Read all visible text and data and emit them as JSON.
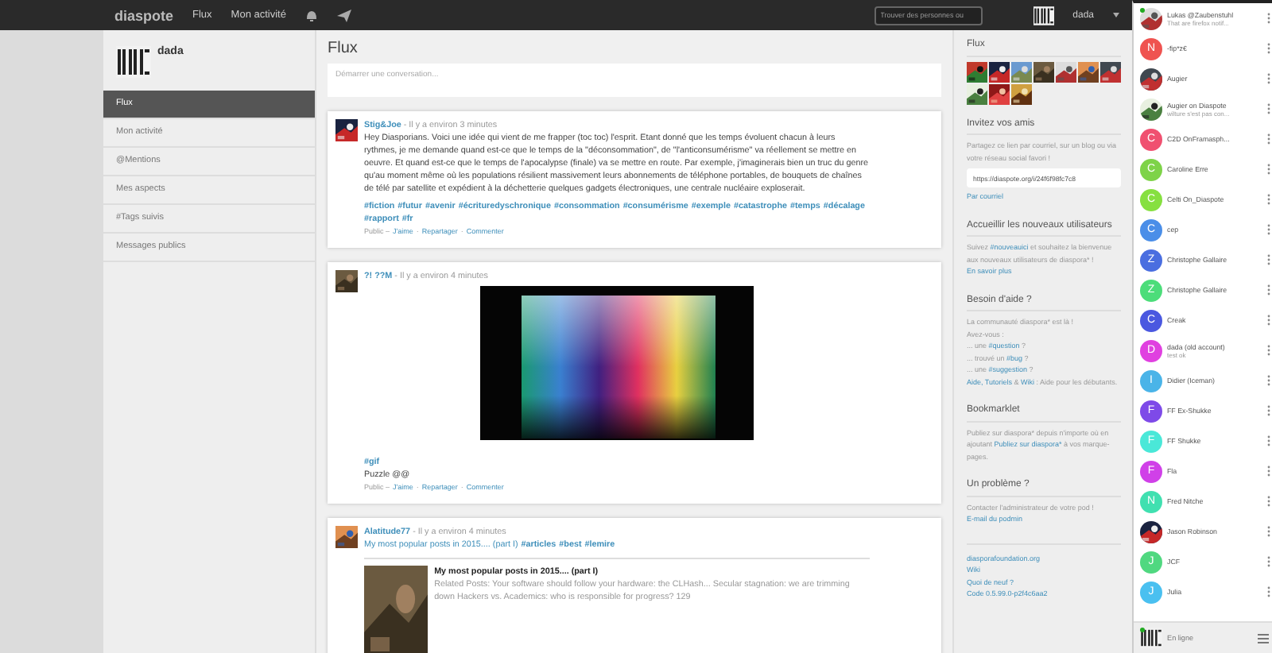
{
  "topbar": {
    "brand": "diaspote",
    "nav": [
      {
        "label": "Flux"
      },
      {
        "label": "Mon activité"
      }
    ],
    "search": {
      "placeholder": "Trouver des personnes ou"
    },
    "user": "dada"
  },
  "sidebar": {
    "user": "dada",
    "items": [
      {
        "label": "Flux",
        "selected": true
      },
      {
        "label": "Mon activité",
        "selected": false
      },
      {
        "label": "@Mentions",
        "selected": false
      },
      {
        "label": "Mes aspects",
        "selected": false
      },
      {
        "label": "#Tags suivis",
        "selected": false
      },
      {
        "label": "Messages publics",
        "selected": false
      }
    ]
  },
  "main": {
    "title": "Flux",
    "composer": {
      "placeholder": "Démarrer une conversation..."
    },
    "posts": [
      {
        "kind": "text",
        "author": "Stig&Joe",
        "time": "- Il y a environ 3 minutes",
        "body": "Hey Diasporians. Voici une idée qui vient de me frapper (toc toc) l'esprit. Etant donné que les temps évoluent chacun à leurs rythmes, je me demande quand est-ce que le temps de la \"déconsommation\", de \"l'anticonsumérisme\" va réellement se mettre en oeuvre. Et quand est-ce que le temps de l'apocalypse (finale) va se mettre en route. Par exemple, j'imaginerais bien un truc du genre qu'au moment même où les populations résilient massivement leurs abonnements de téléphone portables, de bouquets de chaînes de télé par satellite et expédient à la déchetterie quelques gadgets électroniques, une centrale nucléaire exploserait.",
        "tags": [
          "#fiction",
          "#futur",
          "#avenir",
          "#écrituredyschronique",
          "#consommation",
          "#consumérisme",
          "#exemple",
          "#catastrophe",
          "#temps",
          "#décalage",
          "#rapport",
          "#fr"
        ],
        "meta": [
          {
            "kind": "text",
            "text": "Public –"
          },
          {
            "kind": "link",
            "text": "J'aime"
          },
          {
            "kind": "text",
            "text": "·"
          },
          {
            "kind": "link",
            "text": "Repartager"
          },
          {
            "kind": "text",
            "text": "·"
          },
          {
            "kind": "link",
            "text": "Commenter"
          }
        ]
      },
      {
        "author": "?! ??M",
        "time": "- Il y a environ 4 minutes",
        "tags": [
          "#gif"
        ],
        "body": "Puzzle @@",
        "meta": [
          {
            "kind": "text",
            "text": "Public –"
          },
          {
            "kind": "link",
            "text": "J'aime"
          },
          {
            "kind": "text",
            "text": "·"
          },
          {
            "kind": "link",
            "text": "Repartager"
          },
          {
            "kind": "text",
            "text": "·"
          },
          {
            "kind": "link",
            "text": "Commenter"
          }
        ]
      },
      {
        "kind": "link",
        "author": "Alatitude77",
        "time": "- Il y a environ 4 minutes",
        "title": "My most popular posts in 2015.... (part I)",
        "tags": [
          "#articles",
          "#best",
          "#lemire"
        ],
        "embed": {
          "title": "My most popular posts in 2015.... (part I)",
          "description": "Related Posts: Your software should follow your hardware: the CLHash... Secular stagnation: we are trimming down Hackers vs. Academics: who is responsible for progress? 129"
        }
      }
    ]
  },
  "aside": {
    "flux": {
      "title": "Flux"
    },
    "sections": [
      {
        "title": "Invitez vos amis",
        "paragraphs": [
          [
            {
              "kind": "text",
              "text": "Partagez ce lien par courriel, sur un blog ou via votre réseau social favori !"
            }
          ]
        ],
        "field": "https://diaspote.org/i/24f6f98fc7c8",
        "links": [
          "Par courriel"
        ]
      },
      {
        "title": "Accueillir les nouveaux utilisateurs",
        "paragraphs": [
          [
            {
              "kind": "text",
              "text": "Suivez "
            },
            {
              "kind": "link",
              "text": "#nouveauici"
            },
            {
              "kind": "text",
              "text": " et souhaitez la bienvenue aux nouveaux utilisateurs de diaspora* !"
            }
          ]
        ],
        "links": [
          "En savoir plus"
        ]
      },
      {
        "title": "Besoin d'aide ?",
        "paragraphs": [
          [
            {
              "kind": "text",
              "text": "La communauté diaspora* est là !"
            }
          ],
          [
            {
              "kind": "text",
              "text": "Avez-vous :"
            }
          ],
          [
            {
              "kind": "text",
              "text": "... une "
            },
            {
              "kind": "link",
              "text": "#question"
            },
            {
              "kind": "text",
              "text": " ?"
            }
          ],
          [
            {
              "kind": "text",
              "text": "... trouvé un "
            },
            {
              "kind": "link",
              "text": "#bug"
            },
            {
              "kind": "text",
              "text": " ?"
            }
          ],
          [
            {
              "kind": "text",
              "text": "... une "
            },
            {
              "kind": "link",
              "text": "#suggestion"
            },
            {
              "kind": "text",
              "text": " ?"
            }
          ],
          [
            {
              "kind": "link",
              "text": "Aide, Tutoriels"
            },
            {
              "kind": "text",
              "text": " & "
            },
            {
              "kind": "link",
              "text": "Wiki"
            },
            {
              "kind": "text",
              "text": " : Aide pour les débutants."
            }
          ]
        ]
      },
      {
        "title": "Bookmarklet",
        "paragraphs": [
          [
            {
              "kind": "text",
              "text": "Publiez sur diaspora* depuis n'importe où en ajoutant "
            },
            {
              "kind": "link",
              "text": "Publiez sur diaspora*"
            },
            {
              "kind": "text",
              "text": " à vos marque-pages."
            }
          ]
        ]
      },
      {
        "title": "Un problème ?",
        "paragraphs": [
          [
            {
              "kind": "text",
              "text": "Contacter l'administrateur de votre pod !"
            }
          ]
        ],
        "links": [
          "E-mail du podmin"
        ]
      }
    ],
    "footer_links": [
      "diasporafoundation.org",
      "Wiki",
      "Quoi de neuf ?",
      "Code 0.5.99.0-p2f4c6aa2"
    ]
  },
  "chat": {
    "contacts": [
      {
        "name": "Lukas @Zaubenstuhl",
        "status": "That are firefox notif...",
        "online": true
      },
      {
        "name": "-fip*z€",
        "avatar": {
          "kind": "letter",
          "letter": "N",
          "color": "#ef5350"
        },
        "online": false
      },
      {
        "name": "Augier",
        "online": false
      },
      {
        "name": "Augier on Diaspote",
        "status": "wilture s'est pas con...",
        "online": false
      },
      {
        "name": "C2D OnFramasph...",
        "avatar": {
          "kind": "letter",
          "letter": "C",
          "color": "#f05070"
        },
        "online": false
      },
      {
        "name": "Caroline Erre",
        "avatar": {
          "kind": "letter",
          "letter": "C",
          "color": "#7ed348"
        },
        "online": false
      },
      {
        "name": "Celti On_Diaspote",
        "avatar": {
          "kind": "letter",
          "letter": "C",
          "color": "#86e040"
        },
        "online": false
      },
      {
        "name": "cep",
        "avatar": {
          "kind": "letter",
          "letter": "C",
          "color": "#4a8ee8"
        },
        "online": false
      },
      {
        "name": "Christophe Gallaire",
        "avatar": {
          "kind": "letter",
          "letter": "Z",
          "color": "#4a6ee0"
        },
        "online": false
      },
      {
        "name": "Christophe Gallaire",
        "avatar": {
          "kind": "letter",
          "letter": "Z",
          "color": "#4cdd7a"
        },
        "online": false
      },
      {
        "name": "Creak",
        "avatar": {
          "kind": "letter",
          "letter": "C",
          "color": "#4a58e0"
        },
        "online": false
      },
      {
        "name": "dada (old account)",
        "status": "test ok",
        "avatar": {
          "kind": "letter",
          "letter": "D",
          "color": "#e040e0"
        },
        "online": false
      },
      {
        "name": "Didier (Iceman)",
        "avatar": {
          "kind": "letter",
          "letter": "I",
          "color": "#4ab4e8"
        },
        "online": false
      },
      {
        "name": "FF Ex-Shukke",
        "avatar": {
          "kind": "letter",
          "letter": "F",
          "color": "#7e4ae8"
        },
        "online": false
      },
      {
        "name": "FF Shukke",
        "avatar": {
          "kind": "letter",
          "letter": "F",
          "color": "#4ae8d8"
        },
        "online": false
      },
      {
        "name": "Fla",
        "avatar": {
          "kind": "letter",
          "letter": "F",
          "color": "#d040e8"
        },
        "online": false
      },
      {
        "name": "Fred Nitche",
        "avatar": {
          "kind": "letter",
          "letter": "N",
          "color": "#40e0b0"
        },
        "online": false
      },
      {
        "name": "Jason Robinson",
        "online": false
      },
      {
        "name": "JCF",
        "avatar": {
          "kind": "letter",
          "letter": "J",
          "color": "#50d880"
        },
        "online": false
      },
      {
        "name": "Julia",
        "avatar": {
          "kind": "letter",
          "letter": "J",
          "color": "#4ac0f0"
        },
        "online": false
      }
    ],
    "footer": {
      "status": "En ligne",
      "online": true
    }
  }
}
